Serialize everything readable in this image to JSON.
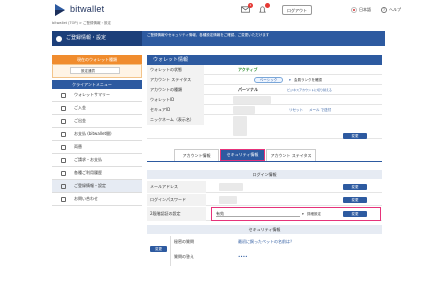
{
  "header": {
    "brand": "bitwallet",
    "mail_badge": "1",
    "logout": "ログアウト",
    "language": "日本語",
    "help": "ヘルプ"
  },
  "breadcrumb": "bitwallet (TOP)  >  ご登録情報・設定",
  "page": {
    "title": "ご登録情報・設定",
    "note": "ご登録情報やセキュリティ情報、各種設定情報をご確認、ご変更いただけます"
  },
  "sidebar": {
    "wallet_head": "現在のウォレット種類",
    "wallet_select": "設定通貨",
    "menu_head": "クライアントメニュー",
    "items": [
      {
        "label": "ウォレットサマリー",
        "icon": "wallet-icon"
      },
      {
        "label": "ご入金",
        "icon": "deposit-icon"
      },
      {
        "label": "ご出金",
        "icon": "withdraw-icon"
      },
      {
        "label": "お支払 (bitwallet間)",
        "icon": "payment-icon"
      },
      {
        "label": "両替",
        "icon": "exchange-icon"
      },
      {
        "label": "ご請求・お支払",
        "icon": "invoice-icon"
      },
      {
        "label": "各種ご利用履歴",
        "icon": "history-icon"
      },
      {
        "label": "ご登録情報・設定",
        "icon": "settings-icon",
        "active": true
      },
      {
        "label": "お問い合わせ",
        "icon": "contact-icon"
      }
    ]
  },
  "wallet_info": {
    "title": "ウォレット情報",
    "rows": [
      {
        "label": "ウォレットの状態",
        "value": "アクティブ"
      },
      {
        "label": "アカウント ステイタス",
        "value": "",
        "pill": "ベーシック",
        "link": "会員ランクを確認"
      },
      {
        "label": "アカウントの種類",
        "value": "パーソナル",
        "link": "ビジネスアカウントに切り替える"
      },
      {
        "label": "ウォレットID",
        "value": ""
      },
      {
        "label": "セキュアID",
        "value": "",
        "links": [
          "リセット",
          "メール で送付"
        ]
      },
      {
        "label": "ニックネーム（表示名）",
        "value": "",
        "button": "変更"
      }
    ]
  },
  "tabs": [
    {
      "label": "アカウント情報",
      "active": false
    },
    {
      "label": "セキュリティ情報",
      "active": true
    },
    {
      "label": "アカウント ステイタス",
      "active": false
    }
  ],
  "login_info": {
    "title": "ログイン情報",
    "rows": [
      {
        "label": "メールアドレス",
        "button": "変更"
      },
      {
        "label": "ログインパスワード",
        "button": "変更"
      },
      {
        "label": "2段階認証の設定",
        "value": "有効",
        "link": "詳細設定",
        "button": "変更"
      }
    ]
  },
  "security_info": {
    "title": "セキュリティ情報",
    "button": "変更",
    "rows": [
      {
        "label": "秘密の質問",
        "value": "最初に飼ったペットの名前は？"
      },
      {
        "label": "質問の答え",
        "value": "••••"
      }
    ]
  },
  "colors": {
    "primary": "#2d5aa0",
    "accent_orange": "#f08c2e",
    "highlight": "#e6337a",
    "active_green": "#2e8b2e"
  }
}
